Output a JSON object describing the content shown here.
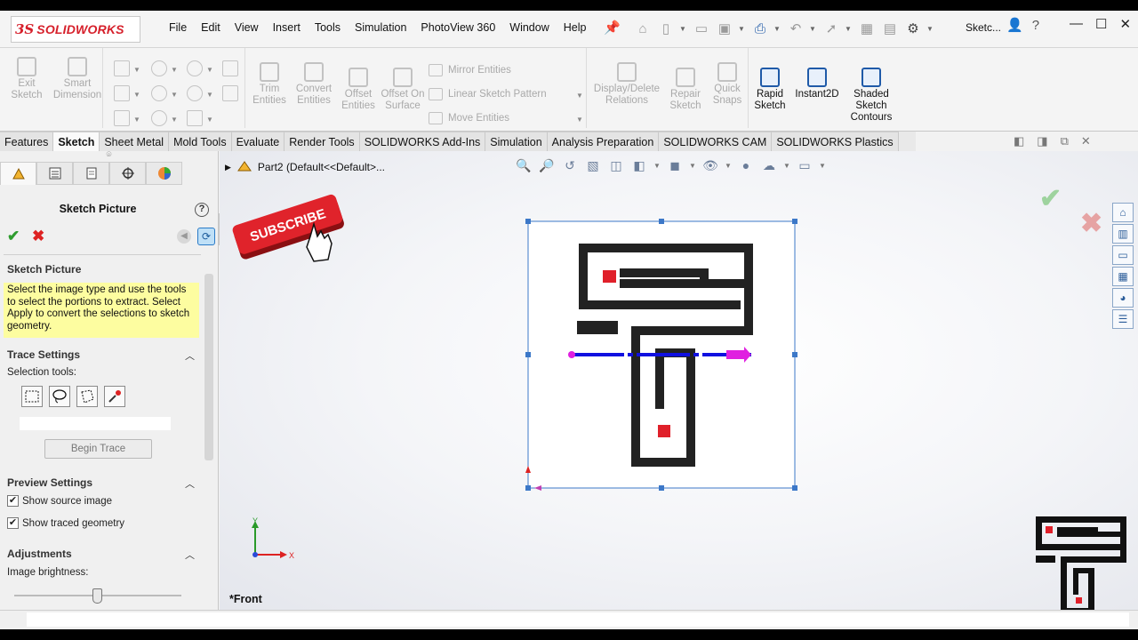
{
  "app": {
    "logo_prefix": "3S",
    "logo_text": "SOLIDWORKS",
    "document_name": "Sketc..."
  },
  "menu": [
    "File",
    "Edit",
    "View",
    "Insert",
    "Tools",
    "Simulation",
    "PhotoView 360",
    "Window",
    "Help"
  ],
  "ribbon": {
    "exit_sketch": "Exit Sketch",
    "smart_dimension": "Smart Dimension",
    "trim_entities": "Trim Entities",
    "convert_entities": "Convert Entities",
    "offset_entities": "Offset Entities",
    "offset_on_surface": "Offset On Surface",
    "mirror_entities": "Mirror Entities",
    "linear_sketch_pattern": "Linear Sketch Pattern",
    "move_entities": "Move Entities",
    "display_delete_relations": "Display/Delete Relations",
    "repair_sketch": "Repair Sketch",
    "quick_snaps": "Quick Snaps",
    "rapid_sketch": "Rapid Sketch",
    "instant2d": "Instant2D",
    "shaded_sketch_contours": "Shaded Sketch Contours"
  },
  "tabs": [
    "Features",
    "Sketch",
    "Sheet Metal",
    "Mold Tools",
    "Evaluate",
    "Render Tools",
    "SOLIDWORKS Add-Ins",
    "Simulation",
    "Analysis Preparation",
    "SOLIDWORKS CAM",
    "SOLIDWORKS Plastics"
  ],
  "active_tab": "Sketch",
  "property_manager": {
    "title": "Sketch Picture",
    "section_sketch_picture": "Sketch Picture",
    "message": "Select the image type and use the tools to select the portions to extract. Select Apply to convert the selections to sketch geometry.",
    "section_trace": "Trace Settings",
    "selection_tools_label": "Selection tools:",
    "begin_trace": "Begin Trace",
    "section_preview": "Preview Settings",
    "show_source_image": "Show source image",
    "show_source_checked": true,
    "show_traced_geometry": "Show traced geometry",
    "show_traced_checked": true,
    "section_adjustments": "Adjustments",
    "image_brightness_label": "Image brightness:",
    "image_brightness_level": 0.5
  },
  "graphics": {
    "tree_node": "Part2  (Default<<Default>...",
    "view_name": "*Front",
    "subscribe_text": "SUBSCRIBE",
    "triad_x": "X",
    "triad_y": "Y"
  },
  "colors": {
    "brand_red": "#d6202b",
    "accent_blue": "#1f5aa8",
    "selection_magenta": "#e020e0",
    "centerline_blue": "#1010e0",
    "logo_black": "#222222",
    "logo_red": "#e0202a"
  }
}
